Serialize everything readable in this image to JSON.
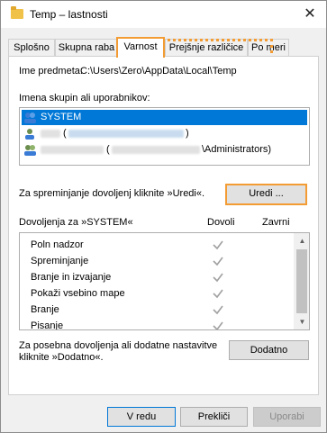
{
  "window": {
    "title": "Temp – lastnosti",
    "close_glyph": "✕"
  },
  "tabs": [
    {
      "label": "Splošno"
    },
    {
      "label": "Skupna raba"
    },
    {
      "label": "Varnost"
    },
    {
      "label": "Prejšnje različice"
    },
    {
      "label": "Po meri"
    }
  ],
  "security": {
    "object_name_label": "Ime predmeta:",
    "object_name_value": "C:\\Users\\Zero\\AppData\\Local\\Temp",
    "groups_label": "Imena skupin ali uporabnikov:",
    "groups": [
      {
        "text": "SYSTEM",
        "icon": "user-group-icon"
      },
      {
        "text": "(",
        "suffix": ")",
        "icon": "user-icon"
      },
      {
        "text": "(",
        "suffix": "\\Administrators)",
        "icon": "user-group-icon"
      }
    ],
    "edit_hint": "Za spreminjanje dovoljenj kliknite »Uredi«.",
    "edit_button": "Uredi ...",
    "permissions_for": "Dovoljenja za »SYSTEM«",
    "col_allow": "Dovoli",
    "col_deny": "Zavrni",
    "permissions": [
      {
        "name": "Poln nadzor",
        "allow": true
      },
      {
        "name": "Spreminjanje",
        "allow": true
      },
      {
        "name": "Branje in izvajanje",
        "allow": true
      },
      {
        "name": "Pokaži vsebino mape",
        "allow": true
      },
      {
        "name": "Branje",
        "allow": true
      },
      {
        "name": "Pisanje",
        "allow": true
      }
    ],
    "advanced_hint_line1": "Za posebna dovoljenja ali dodatne nastavitve",
    "advanced_hint_line2": "kliknite »Dodatno«.",
    "advanced_button": "Dodatno"
  },
  "footer": {
    "ok": "V redu",
    "cancel": "Prekliči",
    "apply": "Uporabi"
  },
  "colors": {
    "highlight": "#f39c33",
    "selection": "#0078d7"
  }
}
